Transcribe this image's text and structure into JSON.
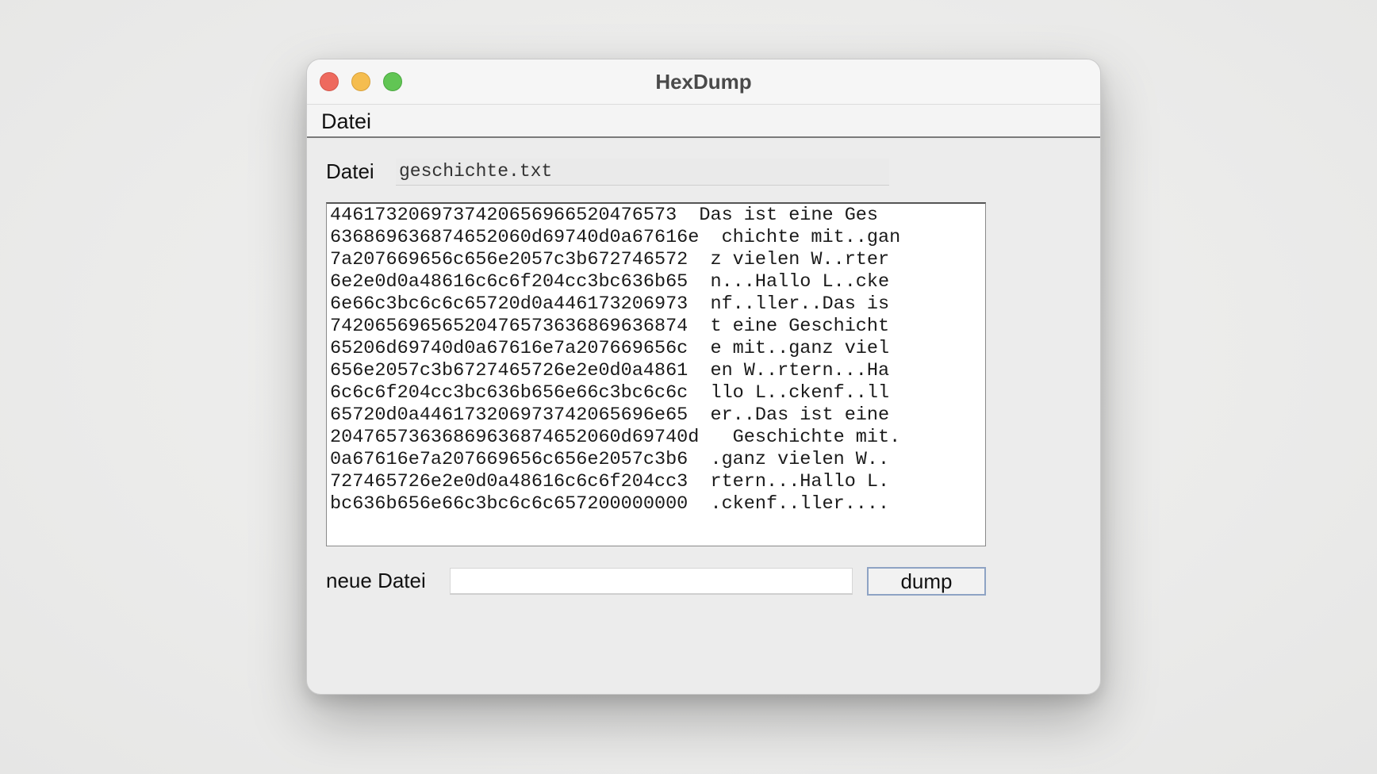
{
  "window": {
    "title": "HexDump"
  },
  "menu": {
    "items": [
      {
        "label": "Datei"
      }
    ]
  },
  "file": {
    "label": "Datei",
    "value": "geschichte.txt"
  },
  "dump": {
    "lines": [
      "4461732069737420656966520476573  Das ist eine Ges",
      "636869636874652060d69740d0a67616e  chichte mit..gan",
      "7a207669656c656e2057c3b672746572  z vielen W..rter",
      "6e2e0d0a48616c6c6f204cc3bc636b65  n...Hallo L..cke",
      "6e66c3bc6c6c65720d0a446173206973  nf..ller..Das is",
      "74206569656520476573636869636874  t eine Geschicht",
      "65206d69740d0a67616e7a207669656c  e mit..ganz viel",
      "656e2057c3b6727465726e2e0d0a4861  en W..rtern...Ha",
      "6c6c6f204cc3bc636b656e66c3bc6c6c  llo L..ckenf..ll",
      "65720d0a446173206973742065696e65  er..Das ist eine",
      "20476573636869636874652060d69740d   Geschichte mit.",
      "0a67616e7a207669656c656e2057c3b6  .ganz vielen W..",
      "727465726e2e0d0a48616c6c6f204cc3  rtern...Hallo L.",
      "bc636b656e66c3bc6c6c657200000000  .ckenf..ller...."
    ]
  },
  "new_file": {
    "label": "neue Datei",
    "value": "",
    "placeholder": ""
  },
  "actions": {
    "dump_label": "dump"
  },
  "colors": {
    "close": "#ee6a5e",
    "minimize": "#f5bd4f",
    "maximize": "#61c554",
    "button_border": "#8ea3c4"
  }
}
